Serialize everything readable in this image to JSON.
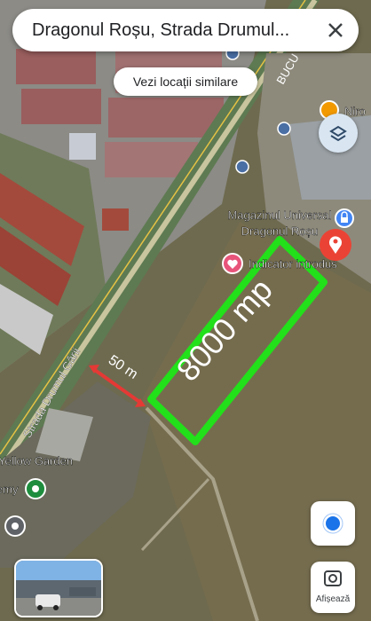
{
  "search": {
    "query": "Dragonul Roșu, Strada Drumul..."
  },
  "chip": {
    "label": "Vezi locații similare"
  },
  "places": {
    "store_line1": "Magazinul Universal",
    "store_line2": "Dragonul Roșu",
    "indicator": "Indicator introdus",
    "yellow_garden": "Yellow Garden",
    "emy": "emy",
    "niro": "Niro"
  },
  "streets": {
    "drumul_garii": "Strada Drumul Gării",
    "bucu": "BUCU"
  },
  "annotations": {
    "area": "8000 mp",
    "distance": "50 m"
  },
  "buttons": {
    "street_view_label": "Afișează"
  },
  "colors": {
    "annotation_green": "#22e01a",
    "annotation_red": "#e53935",
    "pin_red": "#ea4335",
    "poi_blue": "#4285f4",
    "poi_pink": "#e8547a",
    "poi_green": "#1e8e3e"
  },
  "icons": [
    "close-icon",
    "layers-icon",
    "location-pin-icon",
    "my-location-icon",
    "street-view-icon",
    "lock-icon",
    "heart-icon",
    "bus-icon",
    "restaurant-icon"
  ]
}
